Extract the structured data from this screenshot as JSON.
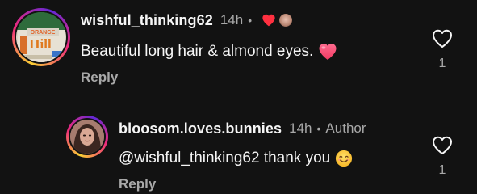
{
  "comments": [
    {
      "username": "wishful_thinking62",
      "time": "14h",
      "text": "Beautiful long hair & almond eyes.",
      "reply_label": "Reply",
      "like_count": "1",
      "avatar_sign": "ORANGE Hill"
    },
    {
      "username": "bloosom.loves.bunnies",
      "time": "14h",
      "author_label": "Author",
      "text": "@wishful_thinking62 thank you",
      "reply_label": "Reply",
      "like_count": "1"
    }
  ],
  "colors": {
    "background": "#121212",
    "primary_text": "#f5f5f5",
    "secondary_text": "#a8a8a8",
    "heart_red": "#ff3040",
    "emoji_heart_pink": "#ff4d7a",
    "smile_yellow": "#ffc83d"
  },
  "icons": {
    "like": "heart-outline-icon",
    "creator_like": "red-heart-icon",
    "emoji_heart": "pink-heart-emoji",
    "emoji_smile": "smiling-face-emoji"
  }
}
